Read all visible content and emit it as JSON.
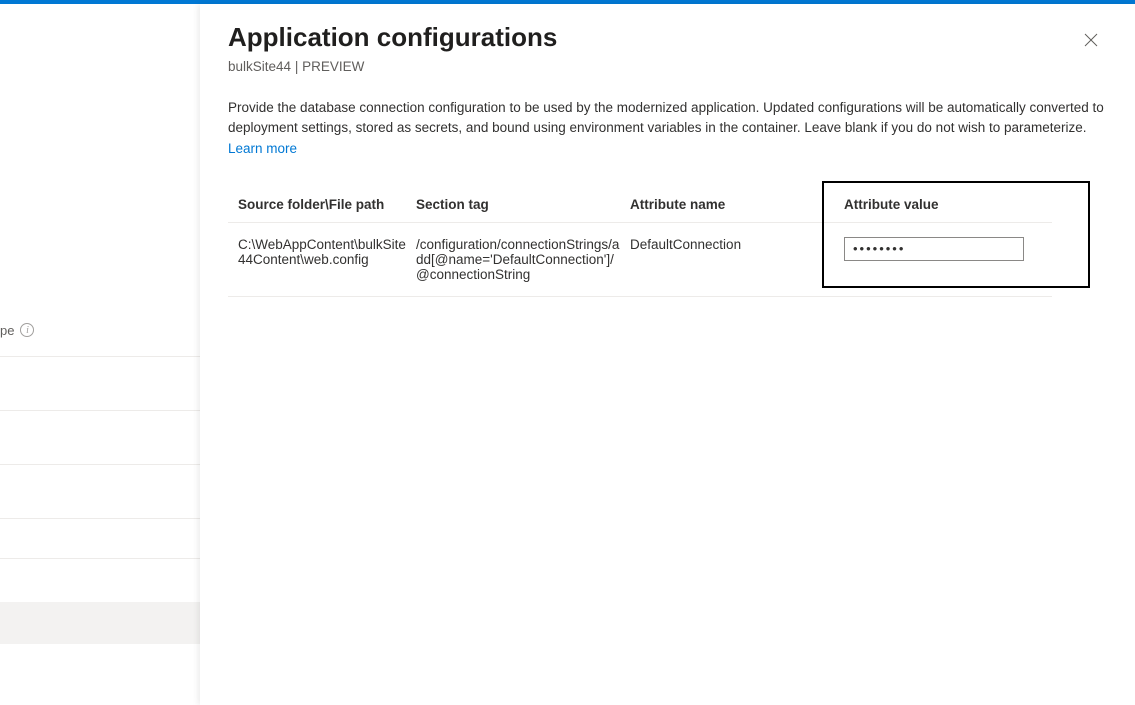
{
  "header": {
    "title": "Application configurations",
    "site": "bulkSite44",
    "preview": "PREVIEW"
  },
  "description": {
    "text": "Provide the database connection configuration to be used by the modernized application. Updated configurations will be automatically converted to deployment settings, stored as secrets, and bound using environment variables in the container. Leave blank if you do not wish to parameterize.",
    "learn_more": "Learn more"
  },
  "table": {
    "headers": {
      "source": "Source folder\\File path",
      "section": "Section tag",
      "attr_name": "Attribute name",
      "attr_value": "Attribute value"
    },
    "row": {
      "source": "C:\\WebAppContent\\bulkSite44Content\\web.config",
      "section": "/configuration/connectionStrings/add[@name='DefaultConnection']/@connectionString",
      "attr_name": "DefaultConnection",
      "attr_value": "••••••••"
    }
  },
  "left": {
    "truncated_label": "pe"
  }
}
